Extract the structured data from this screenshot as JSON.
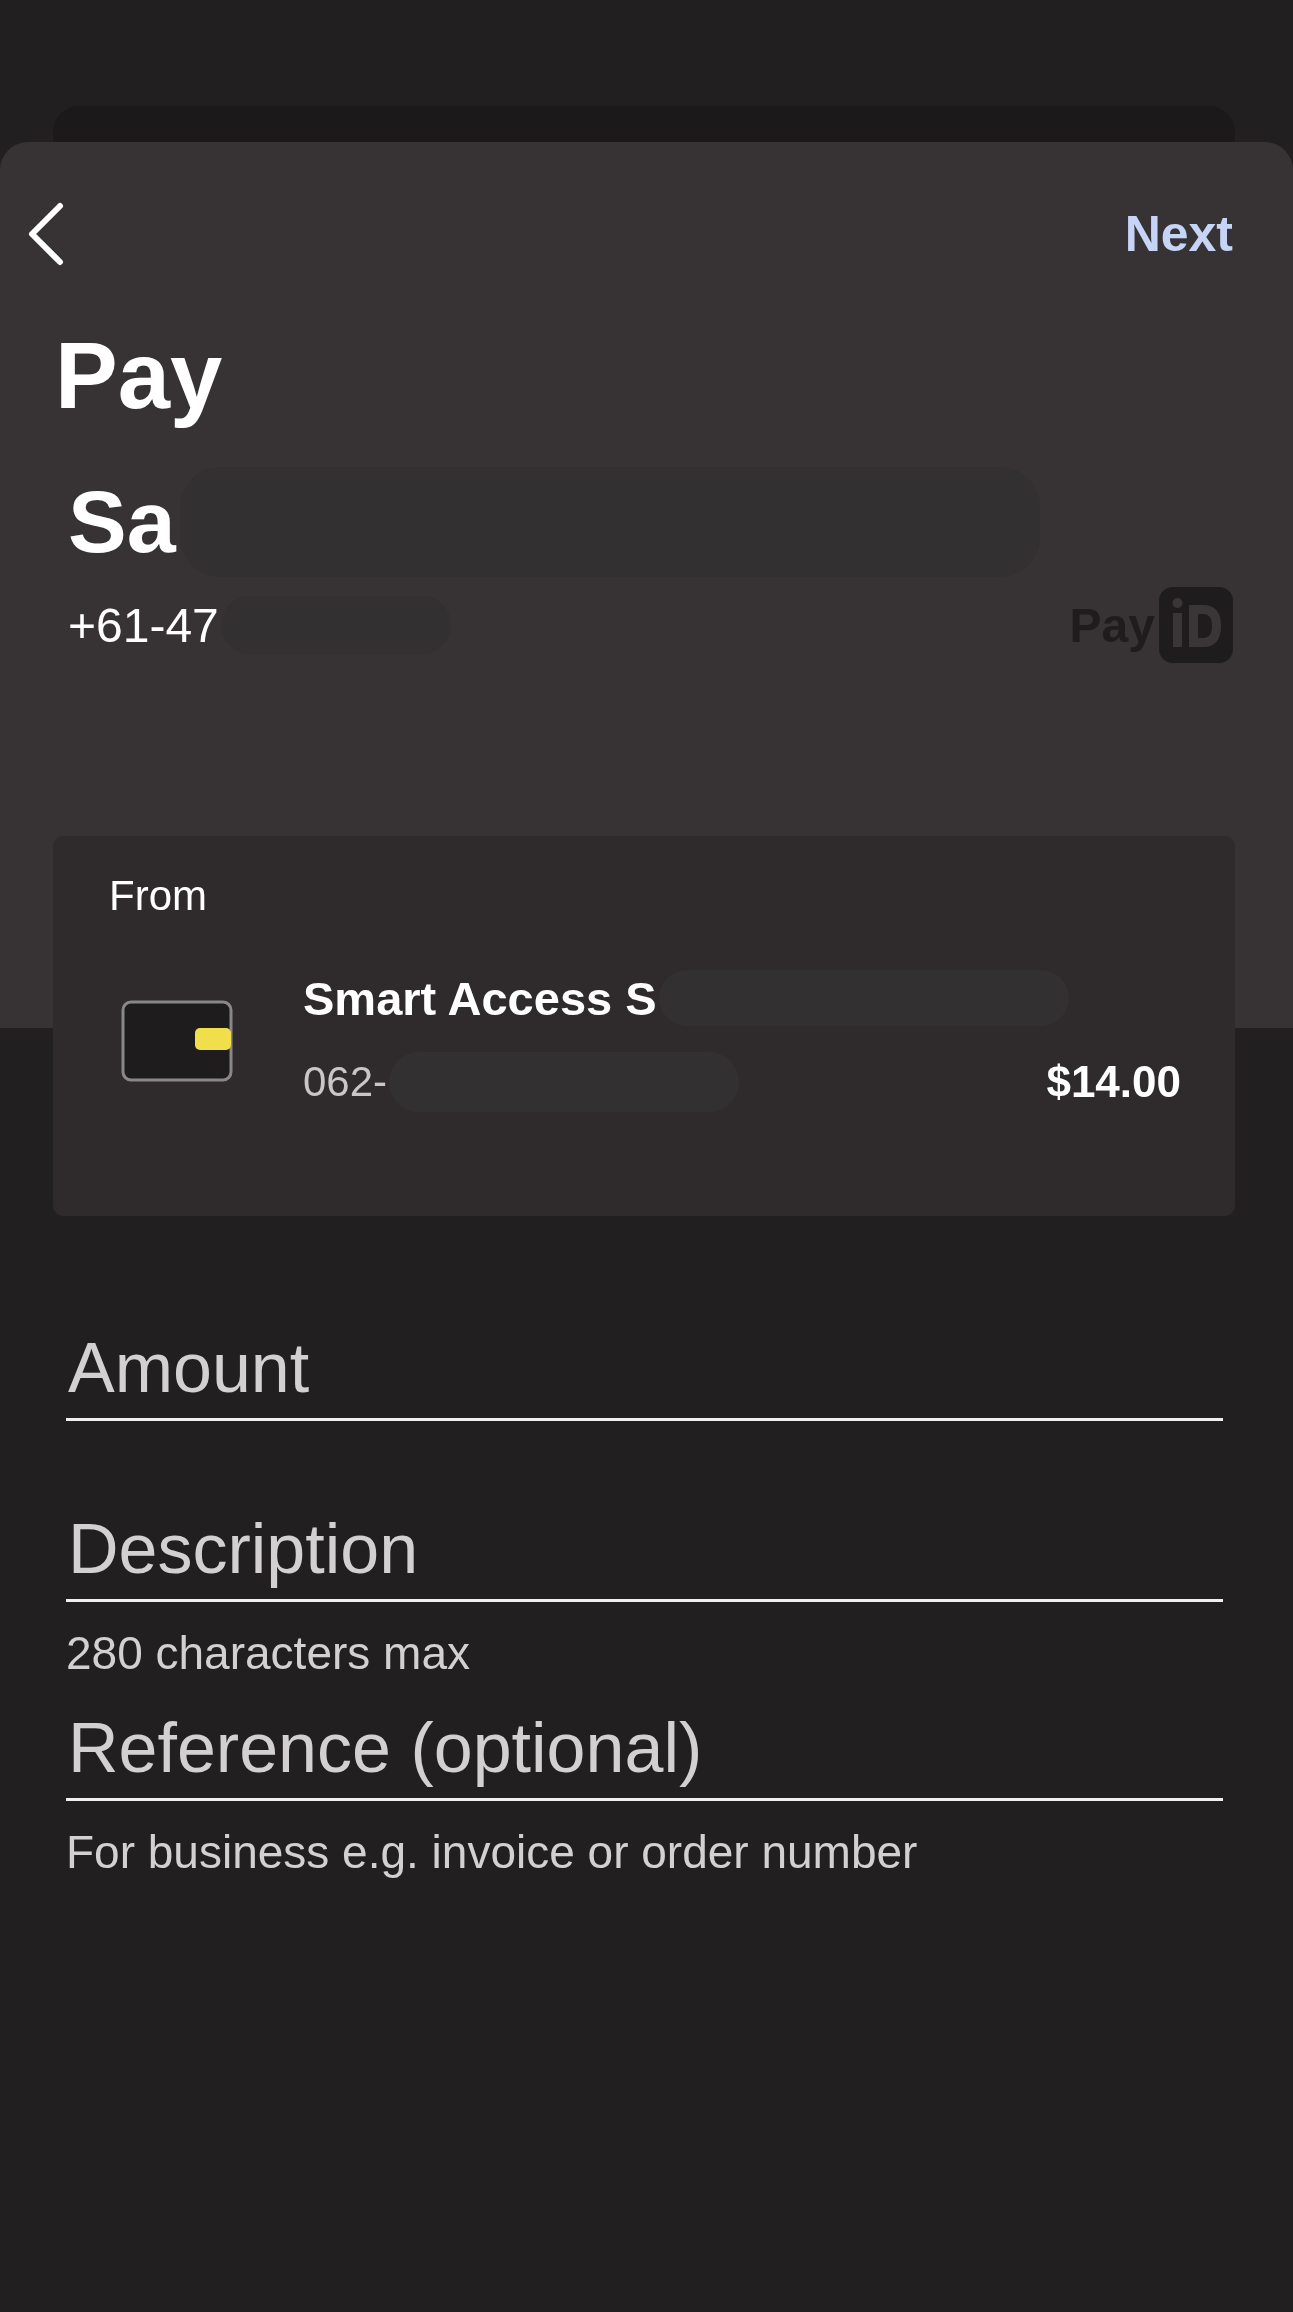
{
  "header": {
    "action": "Next"
  },
  "title": "Pay",
  "payee": {
    "name": "Sa",
    "phone": "+61-47",
    "badge": "Pay"
  },
  "from": {
    "label": "From",
    "account_name": "Smart Access S",
    "account_number": "062-",
    "balance": "$14.00"
  },
  "fields": [
    {
      "placeholder": "Amount"
    },
    {
      "placeholder": "Description",
      "hint": "280 characters max"
    },
    {
      "placeholder": "Reference (optional)",
      "hint": "For business e.g. invoice or order number"
    }
  ]
}
